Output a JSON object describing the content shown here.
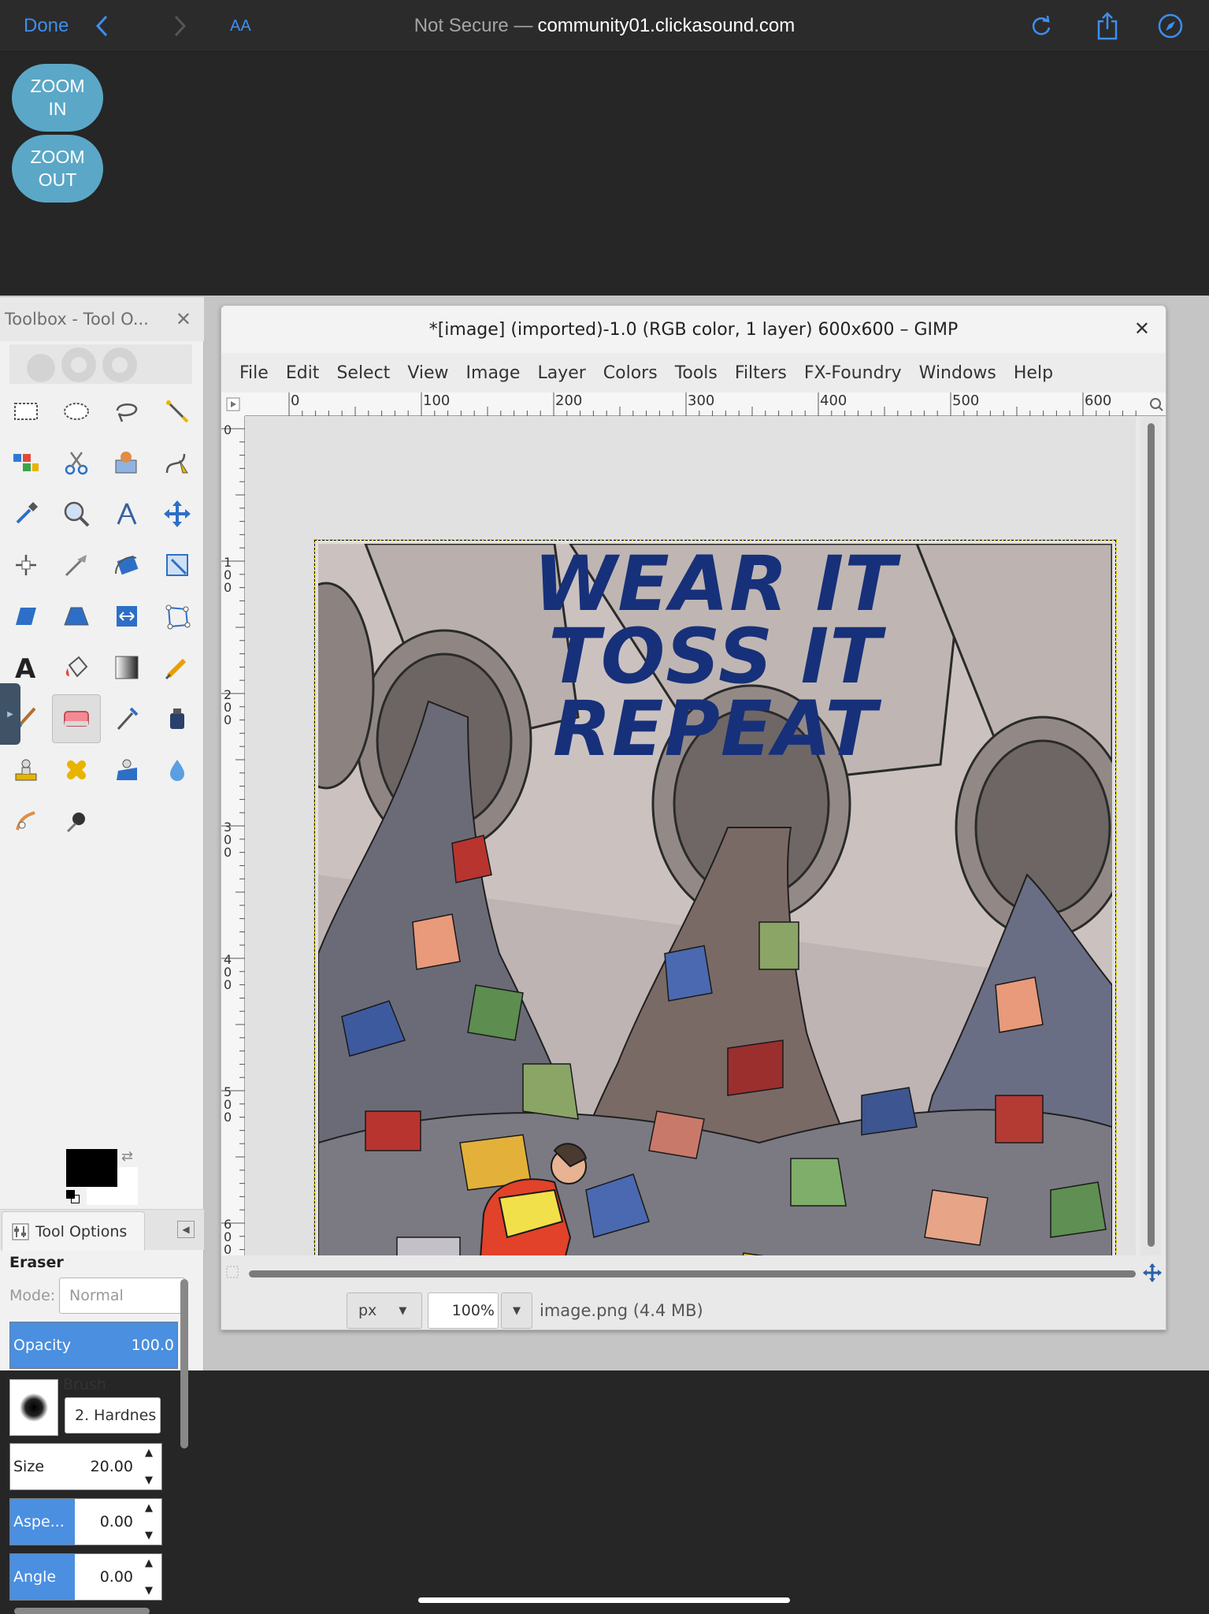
{
  "safari": {
    "done": "Done",
    "text_size": "AA",
    "url_prefix": "Not Secure —",
    "url_host": "community01.clickasound.com"
  },
  "zoom": {
    "in": "ZOOM\nIN",
    "out": "ZOOM\nOUT"
  },
  "toolbox": {
    "title": "Toolbox - Tool O...",
    "tab_label": "Tool Options",
    "tool_name": "Eraser",
    "mode_label": "Mode:",
    "mode_value": "Normal",
    "opacity_label": "Opacity",
    "opacity_value": "100.0",
    "brush_label": "Brush",
    "brush_value": "2. Hardnes",
    "size_label": "Size",
    "size_value": "20.00",
    "aspect_label": "Aspe...",
    "aspect_value": "0.00",
    "angle_label": "Angle",
    "angle_value": "0.00"
  },
  "window": {
    "title": "*[image] (imported)-1.0 (RGB color, 1 layer) 600x600 – GIMP",
    "menus": [
      "File",
      "Edit",
      "Select",
      "View",
      "Image",
      "Layer",
      "Colors",
      "Tools",
      "Filters",
      "FX-Foundry",
      "Windows",
      "Help"
    ],
    "ruler_h": [
      "0",
      "100",
      "200",
      "300",
      "400",
      "500",
      "600"
    ],
    "ruler_v": [
      "0",
      "100",
      "200",
      "300",
      "400",
      "500",
      "600"
    ],
    "unit": "px",
    "zoom_value": "100%",
    "file_info": "image.png (4.4 MB)"
  },
  "poster": {
    "line1": "WEAR IT",
    "line2": "TOSS IT",
    "line3": "REPEAT"
  },
  "colors": {
    "accent": "#3d8ff0",
    "slider_fill": "#4b8fe0",
    "headline": "#17307a",
    "selection": "#e8d400"
  }
}
